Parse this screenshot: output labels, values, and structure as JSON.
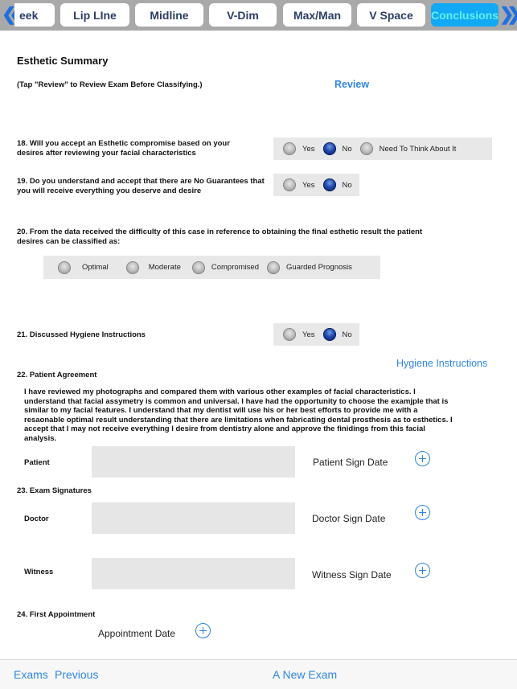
{
  "tabbar": {
    "prev_icon": "double-chevron-left-icon",
    "next_icon": "double-chevron-right-icon",
    "tabs": [
      {
        "label": "eek",
        "active": false
      },
      {
        "label": "Lip LIne",
        "active": false
      },
      {
        "label": "Midline",
        "active": false
      },
      {
        "label": "V-Dim",
        "active": false
      },
      {
        "label": "Max/Man",
        "active": false
      },
      {
        "label": "V Space",
        "active": false
      },
      {
        "label": "Conclusions",
        "active": true
      }
    ]
  },
  "colors": {
    "tab_active_bg": "#12a9f4",
    "tab_active_text": "#5ff0f5",
    "link": "#2f86e0",
    "radio_selected": "#1c45a8"
  },
  "summary": {
    "title": "Esthetic Summary",
    "instruction": "(Tap \"Review\" to Review Exam Before Classifying.)",
    "review_label": "Review"
  },
  "q18": {
    "text": "18.  Will you accept an Esthetic compromise based on your desires after reviewing your facial characteristics",
    "options": [
      "Yes",
      "No",
      "Need To Think About It"
    ],
    "selected": "No"
  },
  "q19": {
    "text": "19.  Do you understand and accept that there are No Guarantees that you will receive everything you deserve and desire",
    "options": [
      "Yes",
      "No"
    ],
    "selected": "No"
  },
  "q20": {
    "text": "20.  From the data received the difficulty of this case in reference to obtaining the final esthetic result the patient desires can be classified as:",
    "options": [
      "Optimal",
      "Moderate",
      "Compromised",
      "Guarded Prognosis"
    ],
    "selected": null
  },
  "q21": {
    "text": "21. Discussed Hygiene Instructions",
    "options": [
      "Yes",
      "No"
    ],
    "selected": "No",
    "hygiene_link": "Hygiene Instructions"
  },
  "q22": {
    "title": "22.  Patient Agreement",
    "agreement": "I have reviewed my photographs and compared them with  various  other examples of facial characteristics.  I understand that facial assymetry is common and universal. I have had the opportunity to choose the examjple that is similar to my facial features. I understand that my dentist will use his or her best efforts to provide me with a resaonable optimal result understanding that there are limitations when fabricating dental prosthesis as to esthetics. I accept that I may not receive everything I desire from dentistry alone and approve the finidings from this facial analysis.",
    "patient_label": "Patient",
    "patient_date_label": "Patient Sign Date"
  },
  "q23": {
    "title": "23.  Exam Signatures",
    "doctor_label": "Doctor",
    "doctor_date_label": "Doctor Sign Date",
    "witness_label": "Witness",
    "witness_date_label": "Witness Sign Date"
  },
  "q24": {
    "title": "24.  First Appointment",
    "appointment_date_label": "Appointment Date"
  },
  "footer": {
    "exams": "Exams",
    "previous": "Previous",
    "new_exam": "A New Exam"
  }
}
